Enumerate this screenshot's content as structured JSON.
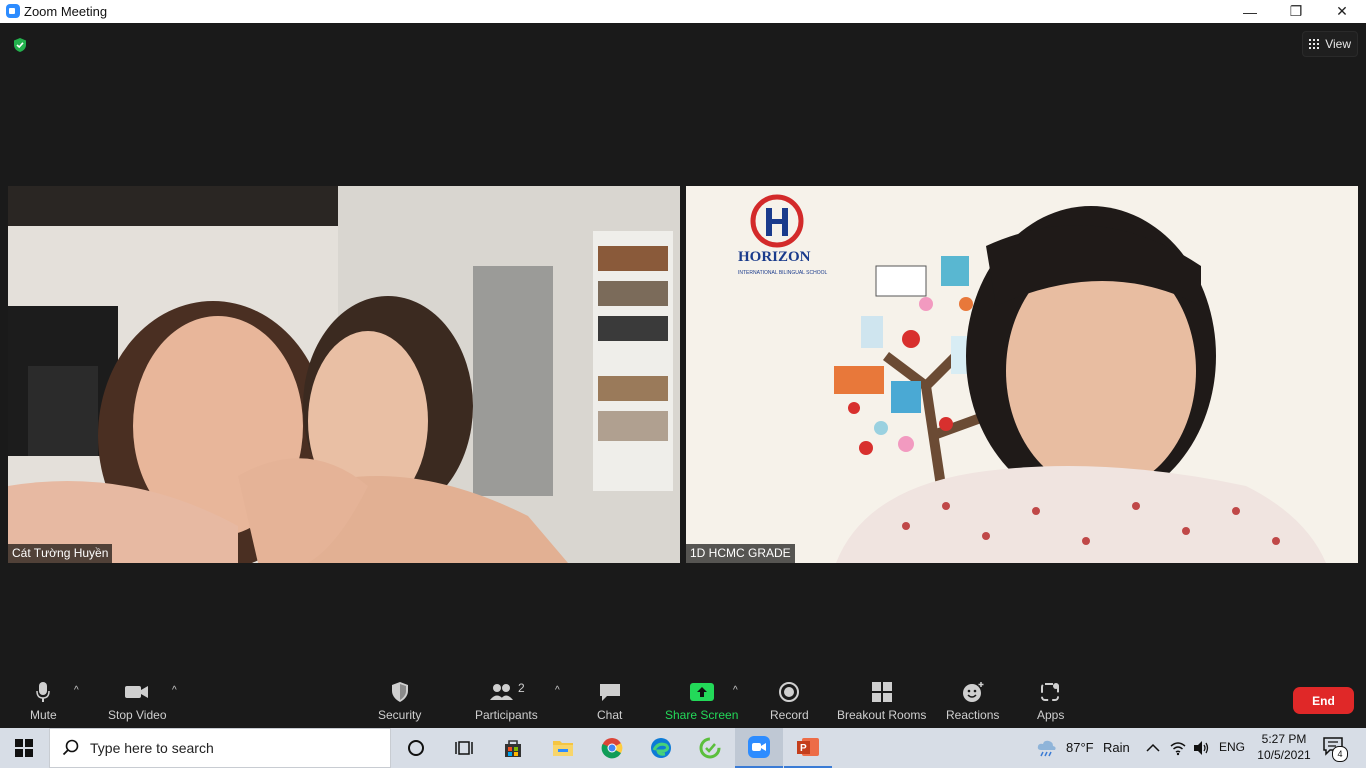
{
  "window": {
    "title": "Zoom Meeting",
    "minimize": "—",
    "maximize": "❐",
    "close": "✕"
  },
  "top": {
    "view_label": "View"
  },
  "tiles": [
    {
      "name": "Cát Tường Huyền"
    },
    {
      "name": "1D HCMC GRADE",
      "logo_text": "HORIZON",
      "logo_sub": "INTERNATIONAL BILINGUAL SCHOOL"
    }
  ],
  "toolbar": {
    "mute": "Mute",
    "stop_video": "Stop Video",
    "security": "Security",
    "participants": "Participants",
    "participants_count": "2",
    "chat": "Chat",
    "share_screen": "Share Screen",
    "record": "Record",
    "breakout_rooms": "Breakout Rooms",
    "reactions": "Reactions",
    "apps": "Apps",
    "end": "End"
  },
  "taskbar": {
    "search_placeholder": "Type here to search",
    "weather_temp": "87°F",
    "weather_desc": "Rain",
    "language": "ENG",
    "time": "5:27 PM",
    "date": "10/5/2021",
    "notifications": "4"
  },
  "colors": {
    "share_green": "#23d959",
    "end_red": "#e02828",
    "zoom_blue": "#2d8cff"
  }
}
